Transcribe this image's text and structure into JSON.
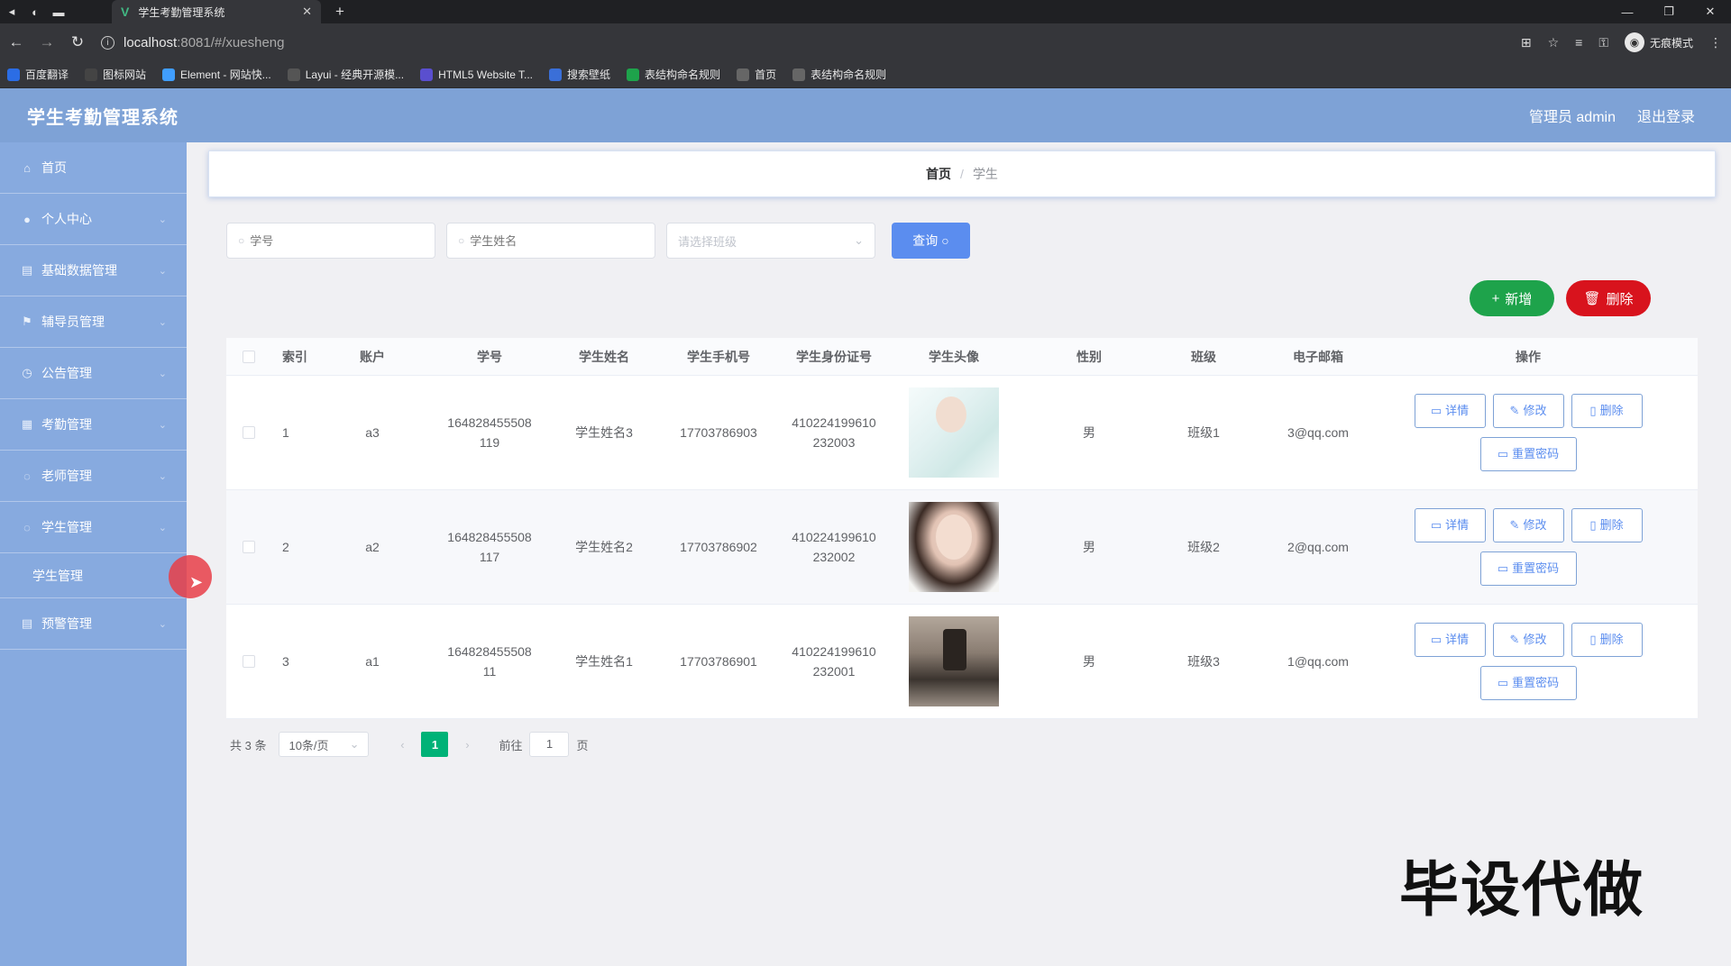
{
  "browser": {
    "tab_title": "学生考勤管理系统",
    "url_host": "localhost",
    "url_path": ":8081/#/xuesheng",
    "incognito_label": "无痕模式",
    "bookmarks": [
      {
        "label": "百度翻译",
        "color": "#2b6de5"
      },
      {
        "label": "图标网站",
        "color": "#444444"
      },
      {
        "label": "Element - 网站快...",
        "color": "#409eff"
      },
      {
        "label": "Layui - 经典开源模...",
        "color": "#555555"
      },
      {
        "label": "HTML5 Website T...",
        "color": "#5a4fcf"
      },
      {
        "label": "搜索壁纸",
        "color": "#3a6fd8"
      },
      {
        "label": "表结构命名规则",
        "color": "#1ea34b"
      },
      {
        "label": "首页",
        "color": "#666666"
      },
      {
        "label": "表结构命名规则",
        "color": "#666666"
      }
    ]
  },
  "header": {
    "title": "学生考勤管理系统",
    "user_label": "管理员 admin",
    "logout_label": "退出登录"
  },
  "sidebar": {
    "items": [
      {
        "label": "首页",
        "icon": "home-icon"
      },
      {
        "label": "个人中心",
        "icon": "user-icon"
      },
      {
        "label": "基础数据管理",
        "icon": "list-icon"
      },
      {
        "label": "辅导员管理",
        "icon": "flag-icon"
      },
      {
        "label": "公告管理",
        "icon": "clock-icon"
      },
      {
        "label": "考勤管理",
        "icon": "calendar-icon"
      },
      {
        "label": "老师管理",
        "icon": "circle-icon"
      },
      {
        "label": "学生管理",
        "icon": "circle-icon"
      }
    ],
    "subitem": "学生管理",
    "last_item": {
      "label": "预警管理",
      "icon": "list-icon"
    }
  },
  "breadcrumb": {
    "home": "首页",
    "separator": "/",
    "current": "学生"
  },
  "search": {
    "no_placeholder": "学号",
    "name_placeholder": "学生姓名",
    "class_placeholder": "请选择班级",
    "query_label": "查询"
  },
  "actions": {
    "add_label": "新增",
    "delete_label": "删除"
  },
  "table": {
    "headers": [
      "索引",
      "账户",
      "学号",
      "学生姓名",
      "学生手机号",
      "学生身份证号",
      "学生头像",
      "性别",
      "班级",
      "电子邮箱",
      "操作"
    ],
    "rows": [
      {
        "idx": "1",
        "account": "a3",
        "no_line1": "164828455508",
        "no_line2": "119",
        "name": "学生姓名3",
        "phone": "17703786903",
        "id_line1": "410224199610",
        "id_line2": "232003",
        "sex": "男",
        "class": "班级1",
        "email": "3@qq.com"
      },
      {
        "idx": "2",
        "account": "a2",
        "no_line1": "164828455508",
        "no_line2": "117",
        "name": "学生姓名2",
        "phone": "17703786902",
        "id_line1": "410224199610",
        "id_line2": "232002",
        "sex": "男",
        "class": "班级2",
        "email": "2@qq.com"
      },
      {
        "idx": "3",
        "account": "a1",
        "no_line1": "164828455508",
        "no_line2": "11",
        "name": "学生姓名1",
        "phone": "17703786901",
        "id_line1": "410224199610",
        "id_line2": "232001",
        "sex": "男",
        "class": "班级3",
        "email": "1@qq.com"
      }
    ],
    "op_labels": {
      "detail": "详情",
      "edit": "修改",
      "delete": "删除",
      "reset": "重置密码"
    }
  },
  "pager": {
    "total": "共 3 条",
    "page_size": "10条/页",
    "current_page": "1",
    "goto_label": "前往",
    "goto_value": "1",
    "page_unit": "页"
  },
  "watermark": "毕设代做"
}
